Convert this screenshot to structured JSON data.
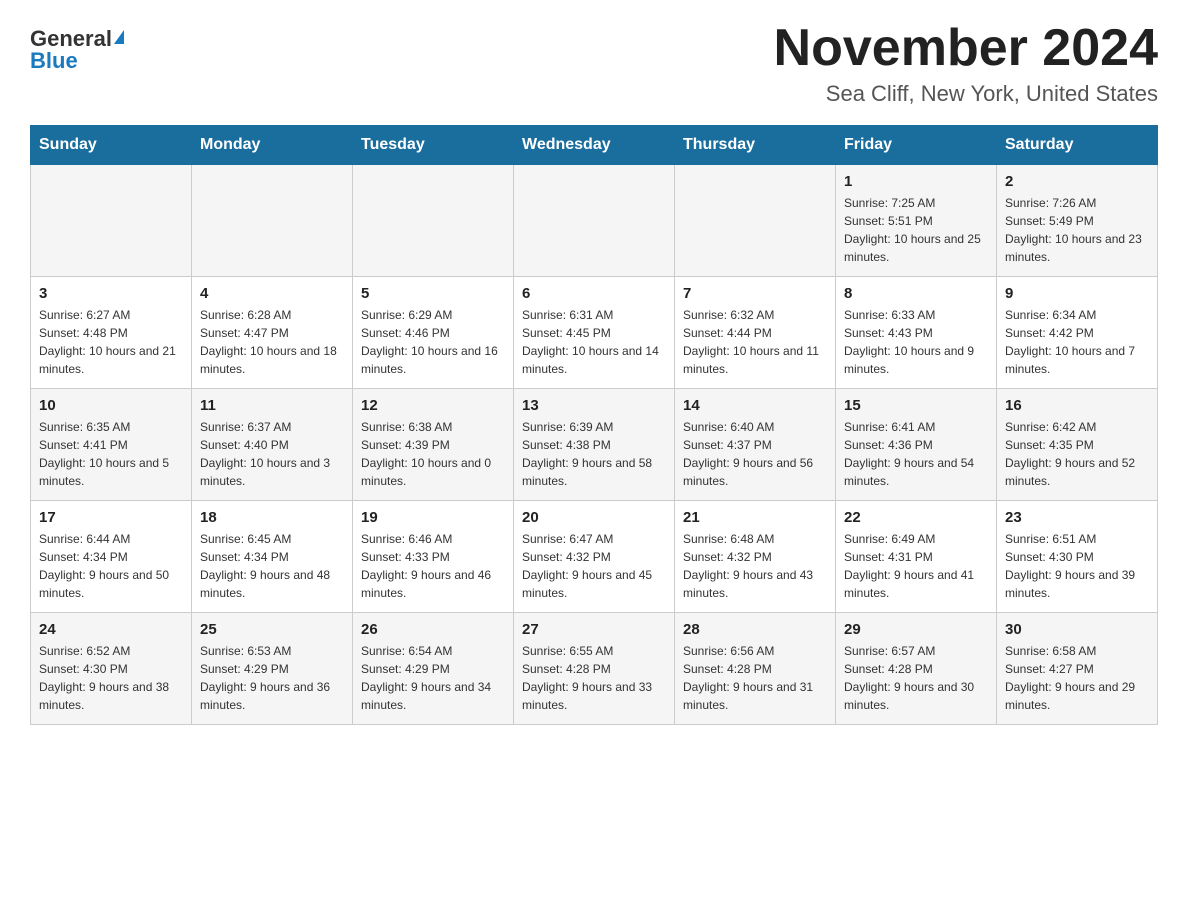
{
  "header": {
    "logo_general": "General",
    "logo_blue": "Blue",
    "month_title": "November 2024",
    "location": "Sea Cliff, New York, United States"
  },
  "weekdays": [
    "Sunday",
    "Monday",
    "Tuesday",
    "Wednesday",
    "Thursday",
    "Friday",
    "Saturday"
  ],
  "weeks": [
    [
      {
        "day": "",
        "info": ""
      },
      {
        "day": "",
        "info": ""
      },
      {
        "day": "",
        "info": ""
      },
      {
        "day": "",
        "info": ""
      },
      {
        "day": "",
        "info": ""
      },
      {
        "day": "1",
        "info": "Sunrise: 7:25 AM\nSunset: 5:51 PM\nDaylight: 10 hours and 25 minutes."
      },
      {
        "day": "2",
        "info": "Sunrise: 7:26 AM\nSunset: 5:49 PM\nDaylight: 10 hours and 23 minutes."
      }
    ],
    [
      {
        "day": "3",
        "info": "Sunrise: 6:27 AM\nSunset: 4:48 PM\nDaylight: 10 hours and 21 minutes."
      },
      {
        "day": "4",
        "info": "Sunrise: 6:28 AM\nSunset: 4:47 PM\nDaylight: 10 hours and 18 minutes."
      },
      {
        "day": "5",
        "info": "Sunrise: 6:29 AM\nSunset: 4:46 PM\nDaylight: 10 hours and 16 minutes."
      },
      {
        "day": "6",
        "info": "Sunrise: 6:31 AM\nSunset: 4:45 PM\nDaylight: 10 hours and 14 minutes."
      },
      {
        "day": "7",
        "info": "Sunrise: 6:32 AM\nSunset: 4:44 PM\nDaylight: 10 hours and 11 minutes."
      },
      {
        "day": "8",
        "info": "Sunrise: 6:33 AM\nSunset: 4:43 PM\nDaylight: 10 hours and 9 minutes."
      },
      {
        "day": "9",
        "info": "Sunrise: 6:34 AM\nSunset: 4:42 PM\nDaylight: 10 hours and 7 minutes."
      }
    ],
    [
      {
        "day": "10",
        "info": "Sunrise: 6:35 AM\nSunset: 4:41 PM\nDaylight: 10 hours and 5 minutes."
      },
      {
        "day": "11",
        "info": "Sunrise: 6:37 AM\nSunset: 4:40 PM\nDaylight: 10 hours and 3 minutes."
      },
      {
        "day": "12",
        "info": "Sunrise: 6:38 AM\nSunset: 4:39 PM\nDaylight: 10 hours and 0 minutes."
      },
      {
        "day": "13",
        "info": "Sunrise: 6:39 AM\nSunset: 4:38 PM\nDaylight: 9 hours and 58 minutes."
      },
      {
        "day": "14",
        "info": "Sunrise: 6:40 AM\nSunset: 4:37 PM\nDaylight: 9 hours and 56 minutes."
      },
      {
        "day": "15",
        "info": "Sunrise: 6:41 AM\nSunset: 4:36 PM\nDaylight: 9 hours and 54 minutes."
      },
      {
        "day": "16",
        "info": "Sunrise: 6:42 AM\nSunset: 4:35 PM\nDaylight: 9 hours and 52 minutes."
      }
    ],
    [
      {
        "day": "17",
        "info": "Sunrise: 6:44 AM\nSunset: 4:34 PM\nDaylight: 9 hours and 50 minutes."
      },
      {
        "day": "18",
        "info": "Sunrise: 6:45 AM\nSunset: 4:34 PM\nDaylight: 9 hours and 48 minutes."
      },
      {
        "day": "19",
        "info": "Sunrise: 6:46 AM\nSunset: 4:33 PM\nDaylight: 9 hours and 46 minutes."
      },
      {
        "day": "20",
        "info": "Sunrise: 6:47 AM\nSunset: 4:32 PM\nDaylight: 9 hours and 45 minutes."
      },
      {
        "day": "21",
        "info": "Sunrise: 6:48 AM\nSunset: 4:32 PM\nDaylight: 9 hours and 43 minutes."
      },
      {
        "day": "22",
        "info": "Sunrise: 6:49 AM\nSunset: 4:31 PM\nDaylight: 9 hours and 41 minutes."
      },
      {
        "day": "23",
        "info": "Sunrise: 6:51 AM\nSunset: 4:30 PM\nDaylight: 9 hours and 39 minutes."
      }
    ],
    [
      {
        "day": "24",
        "info": "Sunrise: 6:52 AM\nSunset: 4:30 PM\nDaylight: 9 hours and 38 minutes."
      },
      {
        "day": "25",
        "info": "Sunrise: 6:53 AM\nSunset: 4:29 PM\nDaylight: 9 hours and 36 minutes."
      },
      {
        "day": "26",
        "info": "Sunrise: 6:54 AM\nSunset: 4:29 PM\nDaylight: 9 hours and 34 minutes."
      },
      {
        "day": "27",
        "info": "Sunrise: 6:55 AM\nSunset: 4:28 PM\nDaylight: 9 hours and 33 minutes."
      },
      {
        "day": "28",
        "info": "Sunrise: 6:56 AM\nSunset: 4:28 PM\nDaylight: 9 hours and 31 minutes."
      },
      {
        "day": "29",
        "info": "Sunrise: 6:57 AM\nSunset: 4:28 PM\nDaylight: 9 hours and 30 minutes."
      },
      {
        "day": "30",
        "info": "Sunrise: 6:58 AM\nSunset: 4:27 PM\nDaylight: 9 hours and 29 minutes."
      }
    ]
  ]
}
